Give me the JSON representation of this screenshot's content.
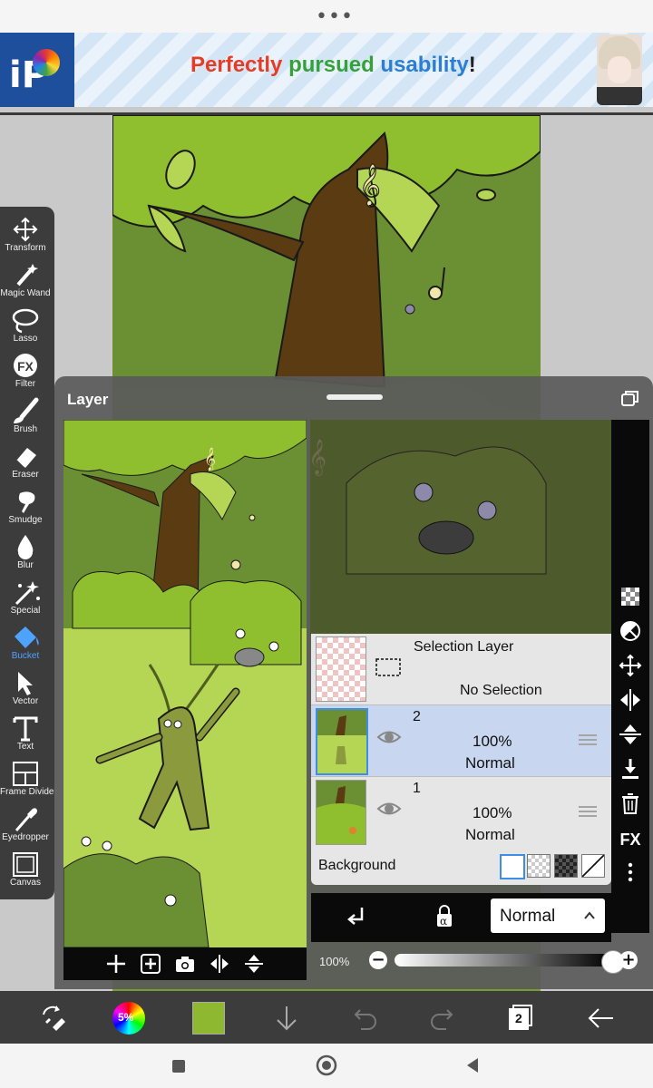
{
  "top_bar": {
    "menu_icon": "more-horizontal-icon"
  },
  "ad": {
    "logo_text": "iP",
    "headline_word1": "Perfectly",
    "headline_word2": "pursued",
    "headline_word3": "usability",
    "headline_punct": "!"
  },
  "tools": [
    {
      "label": "Transform",
      "icon": "move-icon"
    },
    {
      "label": "Magic Wand",
      "icon": "magic-wand-icon"
    },
    {
      "label": "Lasso",
      "icon": "lasso-icon"
    },
    {
      "label": "Filter",
      "icon": "fx-icon"
    },
    {
      "label": "Brush",
      "icon": "brush-icon"
    },
    {
      "label": "Eraser",
      "icon": "eraser-icon"
    },
    {
      "label": "Smudge",
      "icon": "smudge-icon"
    },
    {
      "label": "Blur",
      "icon": "blur-drop-icon"
    },
    {
      "label": "Special",
      "icon": "special-icon"
    },
    {
      "label": "Bucket",
      "icon": "bucket-icon"
    },
    {
      "label": "Vector",
      "icon": "vector-arrow-icon"
    },
    {
      "label": "Text",
      "icon": "text-icon"
    },
    {
      "label": "Frame Divider",
      "icon": "frame-divider-icon"
    },
    {
      "label": "Eyedropper",
      "icon": "eyedropper-icon"
    },
    {
      "label": "Canvas",
      "icon": "canvas-icon"
    }
  ],
  "selected_tool": "Bucket",
  "layer_panel": {
    "title": "Layer",
    "selection_layer": {
      "name": "Selection Layer",
      "status": "No Selection"
    },
    "layers": [
      {
        "number": "2",
        "opacity": "100%",
        "blend": "Normal",
        "selected": true
      },
      {
        "number": "1",
        "opacity": "100%",
        "blend": "Normal",
        "selected": false
      }
    ],
    "background_label": "Background",
    "blend_mode": "Normal",
    "opacity_label": "100%",
    "opacity_value": 1.0,
    "minus_label": "−",
    "plus_label": "+",
    "fx_label": "FX"
  },
  "bottom_bar": {
    "color_wheel_label": "5%",
    "current_color": "#8db82f",
    "layer_count": "2"
  },
  "colors": {
    "accent_blue": "#4ea3ff",
    "selected_layer_bg": "#c8d6ef",
    "panel_bg": "#5a5a5a",
    "toolbar_bg": "#3c3c3c"
  }
}
